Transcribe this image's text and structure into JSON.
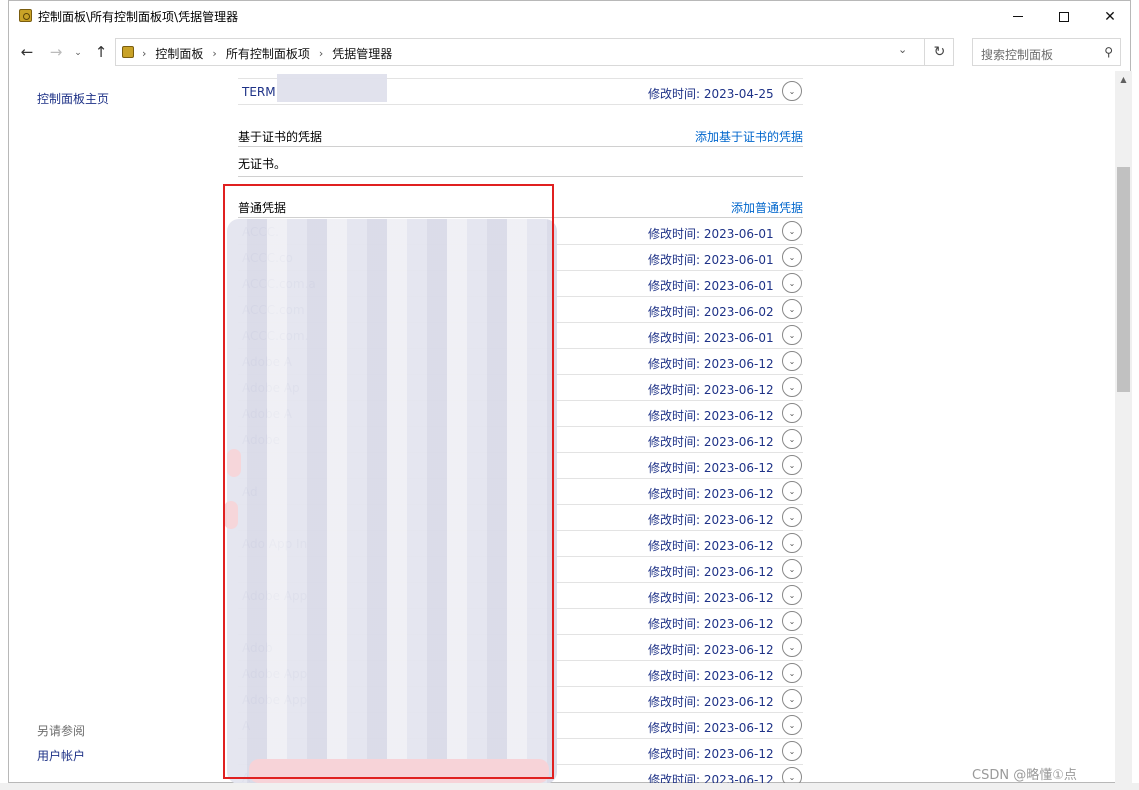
{
  "window": {
    "title": "控制面板\\所有控制面板项\\凭据管理器",
    "controls": {
      "minimize": "—",
      "maximize": "☐",
      "close": "✕"
    }
  },
  "nav": {
    "back_icon": "←",
    "forward_icon": "→",
    "recent_icon": "⌄",
    "up_icon": "↑",
    "crumbs": [
      "控制面板",
      "所有控制面板项",
      "凭据管理器"
    ],
    "crumb_sep": "›",
    "refresh_icon": "↻",
    "search_placeholder": "搜索控制面板",
    "search_icon": "⚲"
  },
  "sidebar": {
    "home": "控制面板主页",
    "see_also": "另请参阅",
    "user_accounts": "用户帐户"
  },
  "main": {
    "top_item": {
      "name": "TERM",
      "modified": "修改时间:  2023-04-25"
    },
    "cert_section": {
      "title": "基于证书的凭据",
      "link": "添加基于证书的凭据",
      "empty": "无证书。"
    },
    "generic_section": {
      "title": "普通凭据",
      "link": "添加普通凭据"
    },
    "generic_items": [
      {
        "name": "ACCC.",
        "modified": "修改时间:  2023-06-01"
      },
      {
        "name": "ACCC.co",
        "modified": "修改时间:  2023-06-01"
      },
      {
        "name": "ACCC.com.a",
        "modified": "修改时间:  2023-06-01"
      },
      {
        "name": "ACCC.com",
        "modified": "修改时间:  2023-06-02"
      },
      {
        "name": "ACCC.com.",
        "modified": "修改时间:  2023-06-01"
      },
      {
        "name": "Adobe A",
        "modified": "修改时间:  2023-06-12"
      },
      {
        "name": "Adobe Ap",
        "modified": "修改时间:  2023-06-12"
      },
      {
        "name": "Adobe A",
        "modified": "修改时间:  2023-06-12"
      },
      {
        "name": "Adobe",
        "modified": "修改时间:  2023-06-12"
      },
      {
        "name": "",
        "modified": "修改时间:  2023-06-12"
      },
      {
        "name": "Ad",
        "modified": "修改时间:  2023-06-12"
      },
      {
        "name": "",
        "modified": "修改时间:  2023-06-12"
      },
      {
        "name": "Ado App In",
        "modified": "修改时间:  2023-06-12"
      },
      {
        "name": "",
        "modified": "修改时间:  2023-06-12"
      },
      {
        "name": "Adobe App",
        "modified": "修改时间:  2023-06-12"
      },
      {
        "name": "",
        "modified": "修改时间:  2023-06-12"
      },
      {
        "name": "Adob",
        "modified": "修改时间:  2023-06-12"
      },
      {
        "name": "Adobe App",
        "modified": "修改时间:  2023-06-12"
      },
      {
        "name": "Adobe App",
        "modified": "修改时间:  2023-06-12"
      },
      {
        "name": "A",
        "modified": "修改时间:  2023-06-12"
      },
      {
        "name": "",
        "modified": "修改时间:  2023-06-12"
      },
      {
        "name": "A",
        "modified": "修改时间:  2023-06-12"
      }
    ],
    "expand_icon": "⌄"
  },
  "watermark": "CSDN @略懂①点",
  "colors": {
    "link": "#1e3287",
    "action_link": "#0066cc",
    "highlight_border": "#e02020"
  }
}
